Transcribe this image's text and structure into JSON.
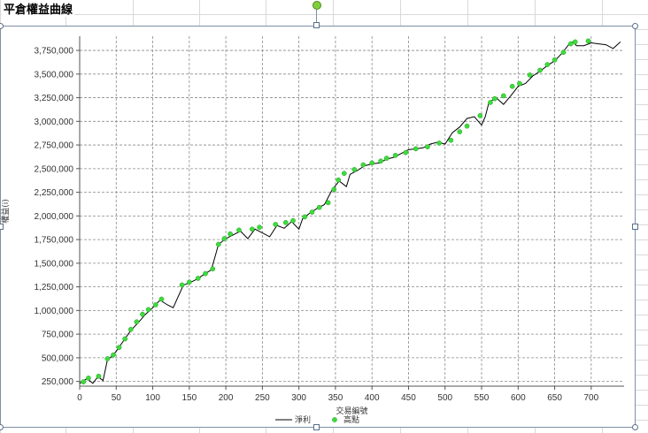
{
  "sheet": {
    "title": "平倉權益曲線"
  },
  "chart_data": {
    "type": "line",
    "xlabel": "交易編號",
    "ylabel": "權益(i)",
    "xlim": [
      0,
      745
    ],
    "ylim": [
      200000,
      3900000
    ],
    "x_ticks": [
      0,
      50,
      100,
      150,
      200,
      250,
      300,
      350,
      400,
      450,
      500,
      550,
      600,
      650,
      700
    ],
    "y_ticks": [
      250000,
      500000,
      750000,
      1000000,
      1250000,
      1500000,
      1750000,
      2000000,
      2250000,
      2500000,
      2750000,
      3000000,
      3250000,
      3500000,
      3750000
    ],
    "y_tick_labels": [
      "250,000",
      "500,000",
      "750,000",
      "1,000,000",
      "1,250,000",
      "1,500,000",
      "1,750,000",
      "2,000,000",
      "2,250,000",
      "2,500,000",
      "2,750,000",
      "3,000,000",
      "3,250,000",
      "3,500,000",
      "3,750,000"
    ],
    "grid": true,
    "legend_position": "bottom",
    "series": [
      {
        "name": "淨利",
        "color": "#000000",
        "kind": "line",
        "x": [
          0,
          10,
          18,
          25,
          32,
          38,
          45,
          52,
          60,
          70,
          80,
          90,
          100,
          110,
          120,
          128,
          135,
          142,
          150,
          160,
          170,
          180,
          185,
          190,
          200,
          210,
          220,
          230,
          240,
          250,
          260,
          270,
          280,
          290,
          300,
          305,
          315,
          325,
          335,
          345,
          355,
          365,
          370,
          380,
          390,
          400,
          410,
          420,
          430,
          440,
          450,
          460,
          470,
          480,
          490,
          500,
          510,
          520,
          530,
          540,
          550,
          555,
          560,
          570,
          580,
          590,
          600,
          610,
          620,
          630,
          640,
          650,
          660,
          670,
          675,
          680,
          690,
          700,
          710,
          720,
          730,
          740
        ],
        "y": [
          230000,
          280000,
          230000,
          300000,
          260000,
          480000,
          520000,
          590000,
          680000,
          790000,
          870000,
          960000,
          1030000,
          1110000,
          1060000,
          1030000,
          1150000,
          1270000,
          1290000,
          1330000,
          1380000,
          1430000,
          1560000,
          1700000,
          1760000,
          1800000,
          1840000,
          1760000,
          1860000,
          1820000,
          1780000,
          1900000,
          1870000,
          1940000,
          1860000,
          1970000,
          2030000,
          2080000,
          2120000,
          2270000,
          2370000,
          2310000,
          2440000,
          2480000,
          2530000,
          2550000,
          2560000,
          2600000,
          2620000,
          2660000,
          2700000,
          2710000,
          2720000,
          2760000,
          2780000,
          2760000,
          2880000,
          2940000,
          3030000,
          3050000,
          2960000,
          3050000,
          3200000,
          3250000,
          3180000,
          3270000,
          3370000,
          3400000,
          3480000,
          3530000,
          3590000,
          3640000,
          3720000,
          3820000,
          3840000,
          3800000,
          3800000,
          3830000,
          3820000,
          3810000,
          3770000,
          3840000
        ]
      },
      {
        "name": "高點",
        "color": "#3ddc3d",
        "kind": "markers",
        "x": [
          5,
          12,
          26,
          38,
          46,
          54,
          62,
          70,
          78,
          86,
          94,
          104,
          112,
          140,
          150,
          162,
          172,
          182,
          190,
          198,
          206,
          218,
          236,
          246,
          268,
          282,
          292,
          308,
          318,
          328,
          340,
          348,
          354,
          362,
          376,
          388,
          400,
          412,
          420,
          432,
          446,
          460,
          476,
          492,
          508,
          520,
          530,
          548,
          562,
          568,
          580,
          592,
          602,
          616,
          630,
          640,
          650,
          662,
          672,
          678,
          696
        ],
        "y": [
          245000,
          285000,
          305000,
          490000,
          530000,
          610000,
          700000,
          800000,
          880000,
          960000,
          1010000,
          1060000,
          1120000,
          1270000,
          1300000,
          1340000,
          1390000,
          1440000,
          1700000,
          1760000,
          1810000,
          1850000,
          1860000,
          1880000,
          1910000,
          1930000,
          1950000,
          1990000,
          2040000,
          2090000,
          2140000,
          2280000,
          2380000,
          2450000,
          2490000,
          2540000,
          2560000,
          2580000,
          2610000,
          2640000,
          2670000,
          2710000,
          2730000,
          2770000,
          2800000,
          2890000,
          2950000,
          3060000,
          3200000,
          3240000,
          3270000,
          3370000,
          3400000,
          3490000,
          3540000,
          3600000,
          3650000,
          3730000,
          3820000,
          3840000,
          3850000
        ]
      }
    ]
  }
}
